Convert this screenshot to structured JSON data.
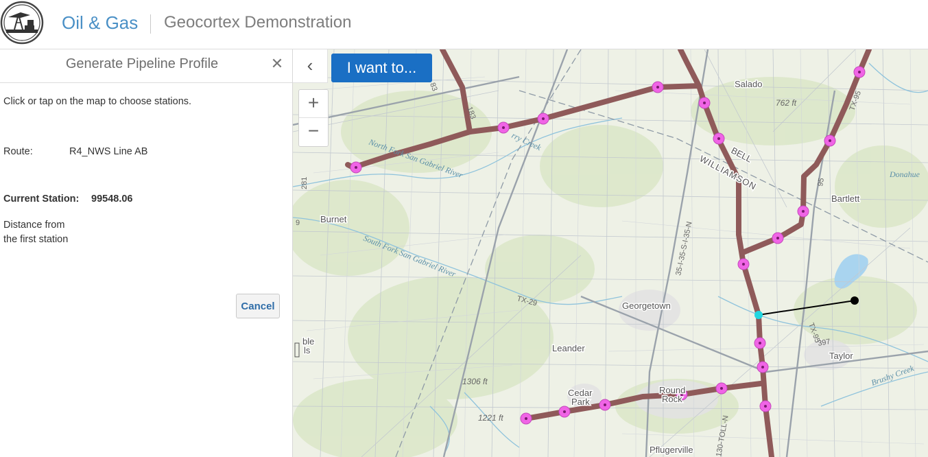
{
  "header": {
    "logo_icon": "oil-derrick-icon",
    "title": "Oil & Gas",
    "subtitle": "Geocortex Demonstration"
  },
  "panel": {
    "title": "Generate Pipeline Profile",
    "close_icon": "close-icon",
    "instructions": "Click or tap on the map to choose stations.",
    "route_label": "Route:",
    "route_value": "R4_NWS Line AB",
    "station_label": "Current Station:",
    "station_value": "99548.06",
    "distance_label": "Distance from the first station",
    "cancel_label": "Cancel"
  },
  "map": {
    "collapse_icon": "chevron-left-icon",
    "iwant_label": "I want to...",
    "zoom_in_label": "+",
    "zoom_out_label": "−",
    "places": {
      "salado": "Salado",
      "bartlett": "Bartlett",
      "burnet": "Burnet",
      "georgetown": "Georgetown",
      "leander": "Leander",
      "taylor": "Taylor",
      "cedar": "Cedar",
      "park": "Park",
      "round": "Round",
      "rock": "Rock",
      "pflugerville": "Pflugerville",
      "williamson": "WILLIAMSON",
      "bell": "BELL",
      "marble": "ble",
      "falls": "ls"
    },
    "water": {
      "north_fork": "North Fork San Gabriel River",
      "south_fork": "South Fork San Gabriel River",
      "berry_creek": "rry Creek",
      "brushy_creek": "Brushy Creek",
      "donahue": "Donahue"
    },
    "elevations": {
      "e762": "762 ft",
      "e1306": "1306 ft",
      "e1221": "1221 ft"
    },
    "roads": {
      "i35": "35-I-35-S-I-35-N",
      "tx95a": "TX-95",
      "tx95b": "TX-95",
      "tx29": "TX-29",
      "r183": "183",
      "r281": "281",
      "r397": "397",
      "r95": "95",
      "r83": "83",
      "toll130": "130-TOLL-N",
      "r9": "9"
    },
    "colors": {
      "pipeline": "#8f5a5a",
      "station_fill": "#f064e6",
      "station_dot": "#7a1a6e",
      "current_station": "#22d6e0",
      "measure_line": "#000000"
    }
  }
}
